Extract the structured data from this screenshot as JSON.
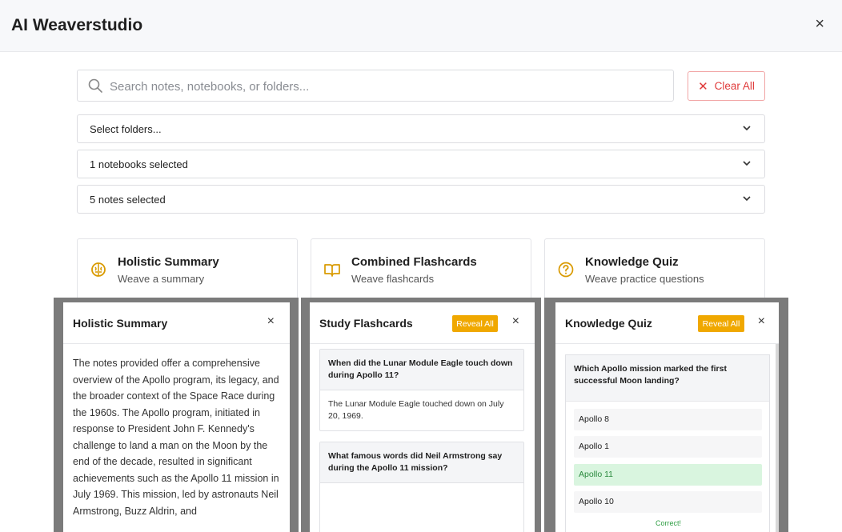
{
  "header": {
    "title": "AI Weaverstudio",
    "close_icon": "×"
  },
  "search": {
    "placeholder": "Search notes, notebooks, or folders...",
    "value": ""
  },
  "clear_all": {
    "label": "Clear All",
    "icon": "✕",
    "color": "#e03b3b"
  },
  "dropdowns": [
    {
      "label": "Select folders..."
    },
    {
      "label": "1 notebooks selected"
    },
    {
      "label": "5 notes selected"
    }
  ],
  "features": [
    {
      "title": "Holistic Summary",
      "subtitle": "Weave a summary",
      "icon": "brain-icon"
    },
    {
      "title": "Combined Flashcards",
      "subtitle": "Weave flashcards",
      "icon": "book-open-icon"
    },
    {
      "title": "Knowledge Quiz",
      "subtitle": "Weave practice questions",
      "icon": "question-circle-icon"
    }
  ],
  "accent_color": "#f0a800",
  "summary_panel": {
    "title": "Holistic Summary",
    "close": "×",
    "text": "The notes provided offer a comprehensive overview of the Apollo program, its legacy, and the broader context of the Space Race during the 1960s. The Apollo program, initiated in response to President John F. Kennedy's challenge to land a man on the Moon by the end of the decade, resulted in significant achievements such as the Apollo 11 mission in July 1969. This mission, led by astronauts Neil Armstrong, Buzz Aldrin, and"
  },
  "flashcards_panel": {
    "title": "Study Flashcards",
    "reveal_label": "Reveal All",
    "close": "×",
    "cards": [
      {
        "question": "When did the Lunar Module Eagle touch down during Apollo 11?",
        "answer": "The Lunar Module Eagle touched down on July 20, 1969."
      },
      {
        "question": "What famous words did Neil Armstrong say during the Apollo 11 mission?",
        "answer": ""
      }
    ]
  },
  "quiz_panel": {
    "title": "Knowledge Quiz",
    "reveal_label": "Reveal All",
    "close": "×",
    "question": "Which Apollo mission marked the first successful Moon landing?",
    "options": [
      "Apollo 8",
      "Apollo 1",
      "Apollo 11",
      "Apollo 10"
    ],
    "selected": "Apollo 11",
    "feedback": "Correct!"
  }
}
